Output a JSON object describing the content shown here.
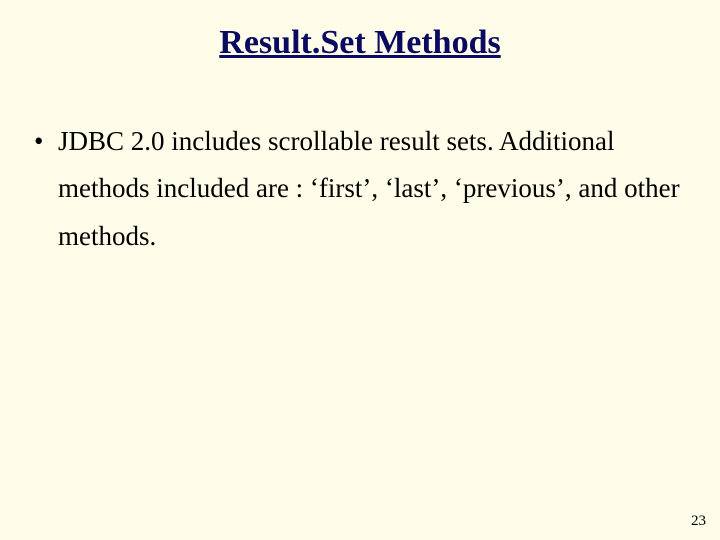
{
  "slide": {
    "title": "Result.Set Methods",
    "bullets": [
      "JDBC 2.0 includes scrollable result sets. Additional methods included are : ‘first’, ‘last’, ‘previous’, and other methods."
    ],
    "page_number": "23"
  }
}
